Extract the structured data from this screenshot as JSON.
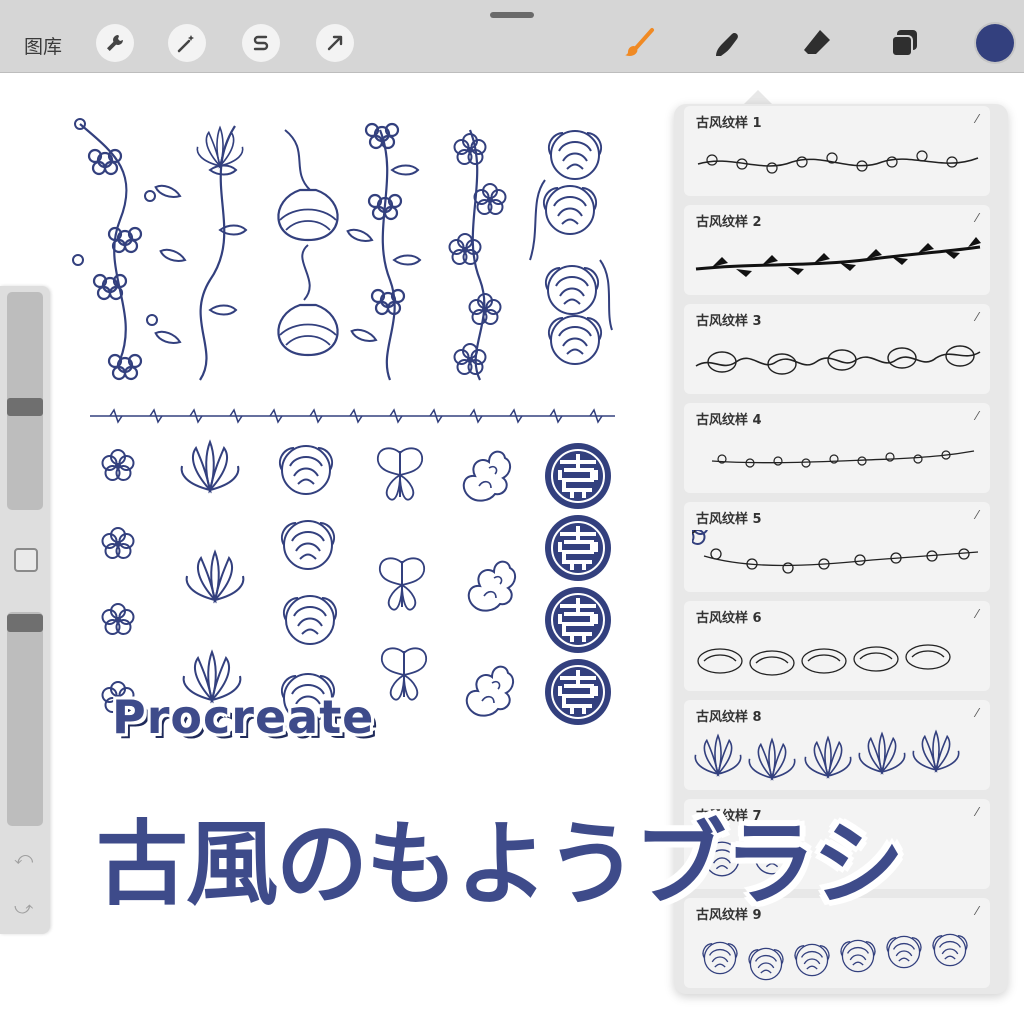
{
  "toolbar": {
    "gallery_label": "图库",
    "left_tools": [
      "wrench-icon",
      "magic-wand-icon",
      "selection-s-icon",
      "arrow-cursor-icon"
    ],
    "right_tools": [
      "brush-icon",
      "smudge-icon",
      "eraser-icon",
      "layers-icon"
    ],
    "current_color": "#33407e"
  },
  "brush_library": {
    "items": [
      {
        "name": "古风纹样 1"
      },
      {
        "name": "古风纹样 2"
      },
      {
        "name": "古风纹样 3"
      },
      {
        "name": "古风纹样 4"
      },
      {
        "name": "古风纹样 5"
      },
      {
        "name": "古风纹样 6"
      },
      {
        "name": "古风纹样 8"
      },
      {
        "name": "古风纹样 7"
      },
      {
        "name": "古风纹样 9"
      }
    ]
  },
  "overlay": {
    "app_name": "Procreate",
    "headline": "古風のもようブラシ"
  },
  "colors": {
    "accent": "#33407e",
    "brush_active": "#f08a24"
  }
}
